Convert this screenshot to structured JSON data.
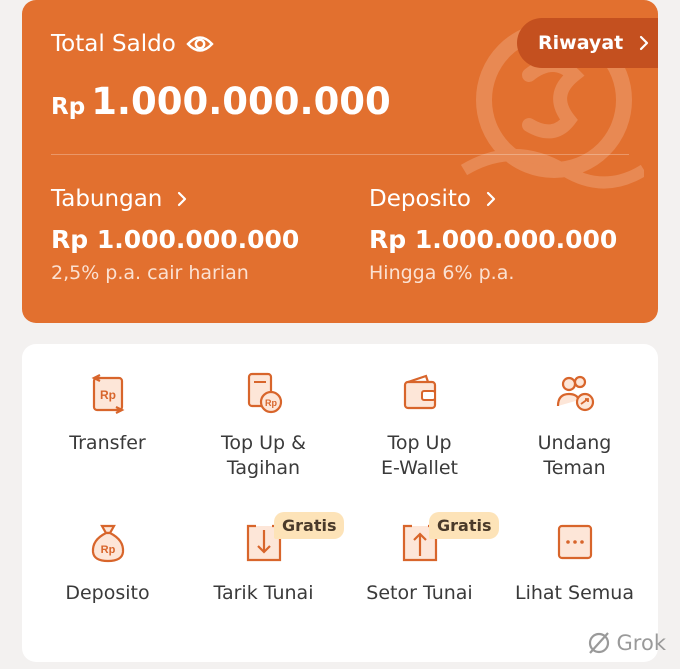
{
  "balance": {
    "label": "Total Saldo",
    "currency": "Rp",
    "amount": "1.000.000.000",
    "history_label": "Riwayat"
  },
  "accounts": [
    {
      "title": "Tabungan",
      "amount": "Rp 1.000.000.000",
      "note": "2,5% p.a. cair harian"
    },
    {
      "title": "Deposito",
      "amount": "Rp 1.000.000.000",
      "note": "Hingga 6% p.a."
    }
  ],
  "menu": [
    {
      "label_lines": [
        "Transfer"
      ],
      "icon": "transfer-icon"
    },
    {
      "label_lines": [
        "Top Up &",
        "Tagihan"
      ],
      "icon": "bill-icon"
    },
    {
      "label_lines": [
        "Top Up",
        "E-Wallet"
      ],
      "icon": "wallet-icon"
    },
    {
      "label_lines": [
        "Undang",
        "Teman"
      ],
      "icon": "invite-friends-icon"
    },
    {
      "label_lines": [
        "Deposito"
      ],
      "icon": "money-bag-icon"
    },
    {
      "label_lines": [
        "Tarik Tunai"
      ],
      "icon": "withdraw-icon",
      "badge": "Gratis"
    },
    {
      "label_lines": [
        "Setor Tunai"
      ],
      "icon": "deposit-cash-icon",
      "badge": "Gratis"
    },
    {
      "label_lines": [
        "Lihat Semua"
      ],
      "icon": "more-icon"
    }
  ],
  "watermark": "Grok",
  "colors": {
    "primary": "#e2702f",
    "history_button": "#c4501f",
    "icon_accent": "#d8652b",
    "badge_bg": "#fde3b8"
  }
}
